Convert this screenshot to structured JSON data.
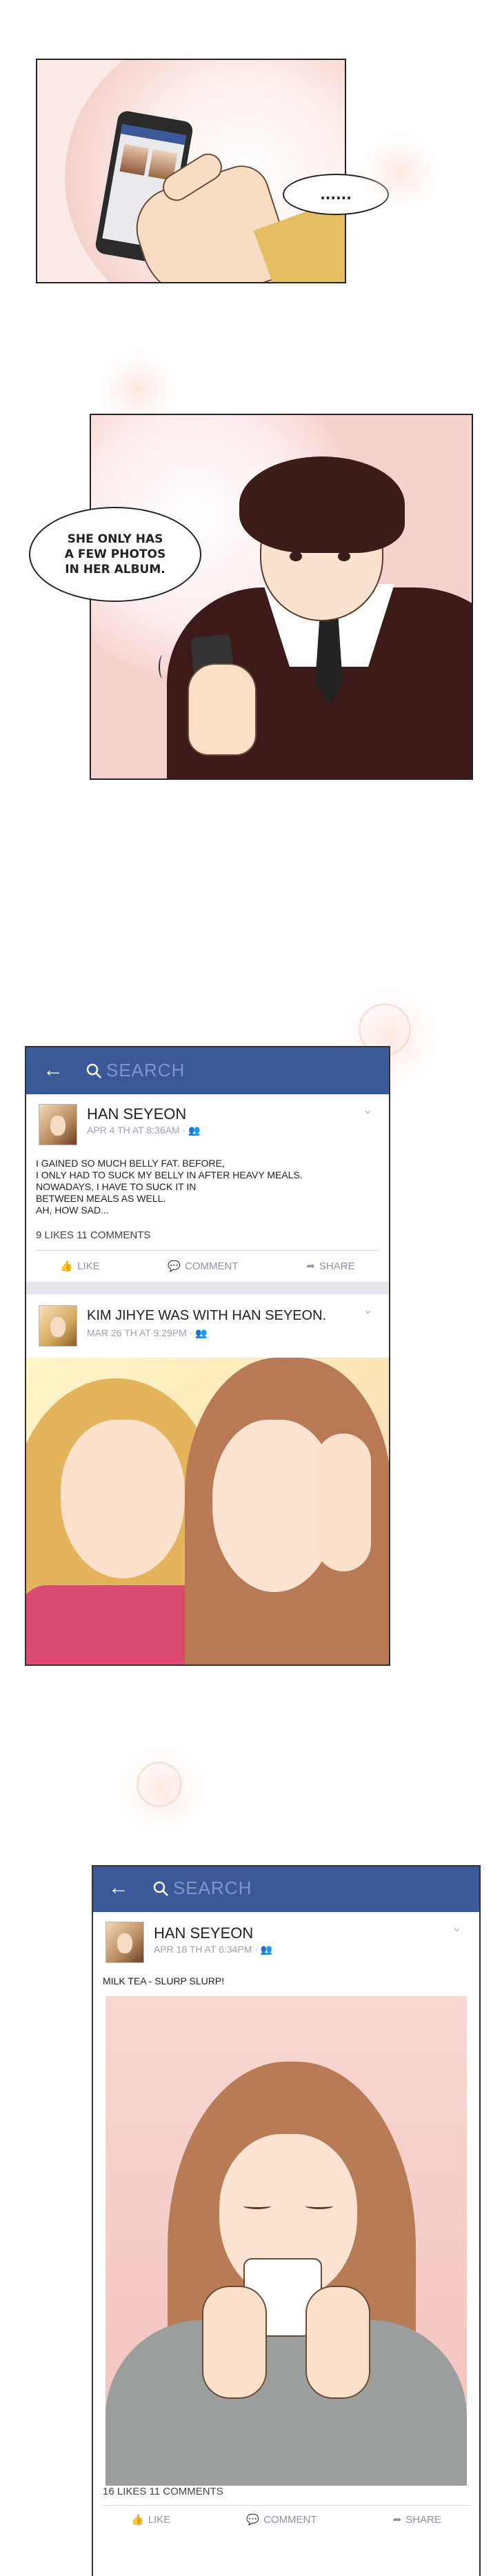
{
  "bubbles": {
    "ellipsis": "......",
    "album_line1": "SHE ONLY HAS",
    "album_line2": "A FEW PHOTOS",
    "album_line3": "IN HER ALBUM."
  },
  "search_placeholder": "SEARCH",
  "post1": {
    "name": "HAN SEYEON",
    "meta": "APR 4 TH AT 8:36AM",
    "lines": [
      "I GAINED SO MUCH BELLY FAT. BEFORE,",
      "I ONLY HAD TO SUCK MY BELLY IN AFTER HEAVY MEALS.",
      "NOWADAYS, I HAVE TO SUCK IT IN",
      "BETWEEN MEALS AS WELL.",
      "AH, HOW SAD..."
    ],
    "counts": "9 LIKES 11 COMMENTS"
  },
  "post2": {
    "name": "KIM JIHYE",
    "with_text": "WAS WITH",
    "tagged": "HAN SEYEON.",
    "meta": "MAR 26 TH AT 9:29PM"
  },
  "post3": {
    "name": "HAN SEYEON",
    "meta": "APR 18 TH AT 6:34PM",
    "body": "MILK TEA - SLURP SLURP!",
    "counts": "16 LIKES 11 COMMENTS"
  },
  "actions": {
    "like": "LIKE",
    "comment": "COMMENT",
    "share": "SHARE"
  },
  "colors": {
    "facebook_blue": "#3b5998",
    "panel_pink": "#f5c9c6"
  }
}
